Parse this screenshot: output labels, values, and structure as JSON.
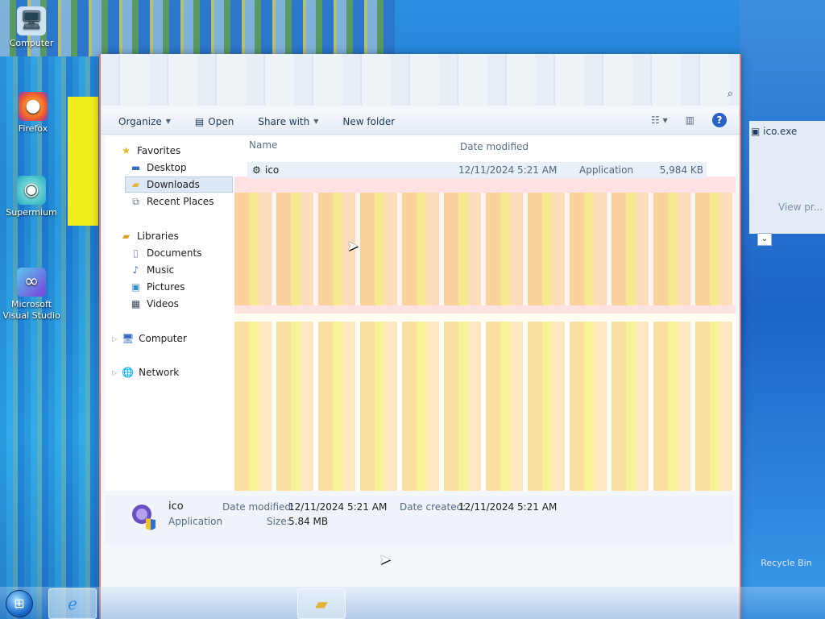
{
  "desktop": {
    "icons": [
      {
        "label": "Computer",
        "glyph": "computer-icon"
      },
      {
        "label": "Firefox",
        "glyph": "firefox-icon"
      },
      {
        "label": "Supermium",
        "glyph": "supermium-icon"
      },
      {
        "label": "Microsoft Visual Studio",
        "glyph": "visual-studio-icon"
      }
    ]
  },
  "side_window": {
    "title": "ico.exe",
    "text": "View pr..."
  },
  "toolbar": {
    "organize": "Organize",
    "open": "Open",
    "share_with": "Share with",
    "new_folder": "New folder"
  },
  "nav": {
    "favorites": "Favorites",
    "desktop": "Desktop",
    "downloads": "Downloads",
    "recent_places": "Recent Places",
    "libraries": "Libraries",
    "documents": "Documents",
    "music": "Music",
    "pictures": "Pictures",
    "videos": "Videos",
    "computer": "Computer",
    "network": "Network"
  },
  "columns": {
    "name": "Name",
    "date_modified": "Date modified"
  },
  "files": [
    {
      "name": "ico",
      "date_modified": "12/11/2024 5:21 AM",
      "type": "Application",
      "size": "5,984 KB"
    }
  ],
  "details": {
    "name": "ico",
    "type": "Application",
    "date_modified_label": "Date modified:",
    "date_modified": "12/11/2024 5:21 AM",
    "date_created_label": "Date created:",
    "date_created": "12/11/2024 5:21 AM",
    "size_label": "Size:",
    "size": "5.84 MB"
  },
  "recycle_bin": "Recycle Bin",
  "colors": {
    "accent": "#2a63c7",
    "window_border": "#d7787a",
    "selection": "#dde8f6"
  }
}
